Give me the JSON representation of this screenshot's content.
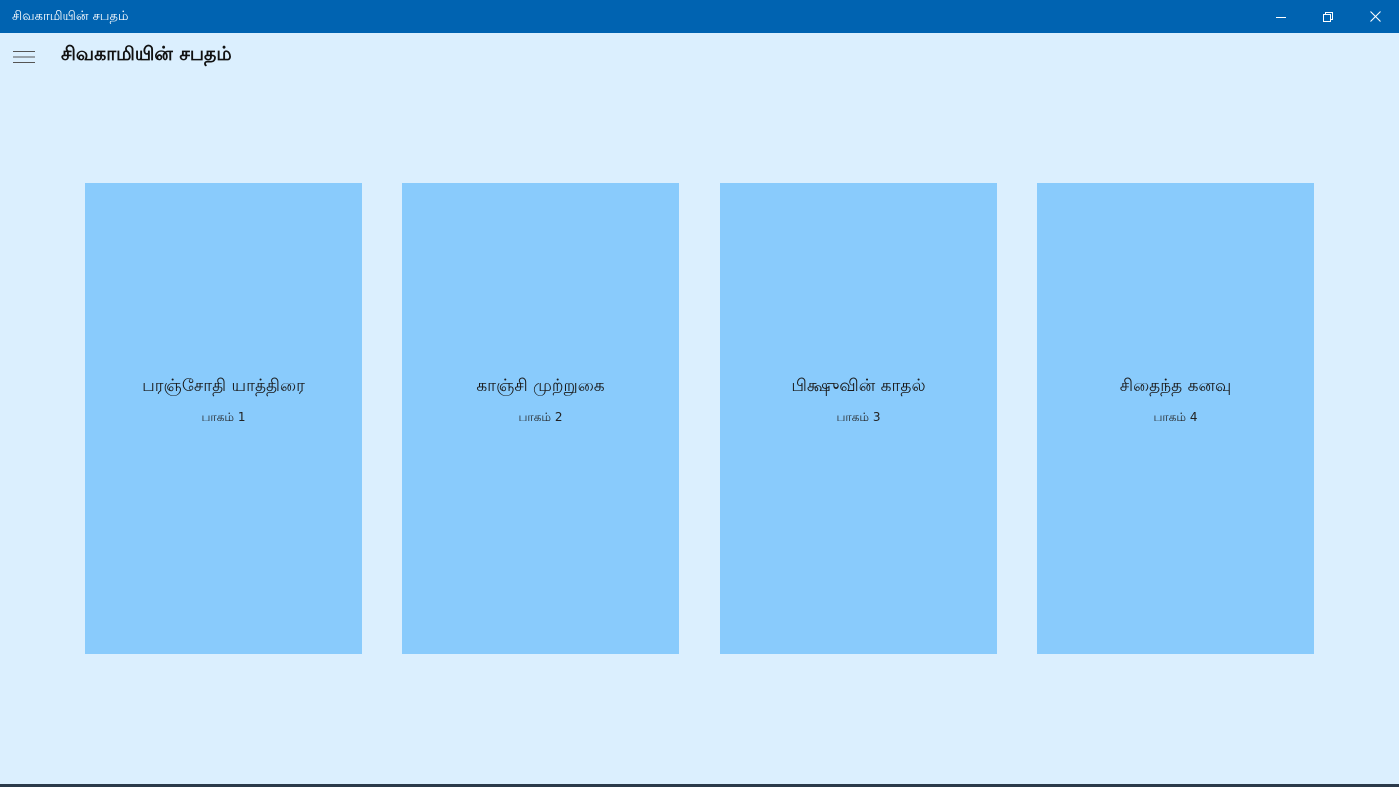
{
  "window": {
    "title": "சிவகாமியின் சபதம்",
    "titlebar_color": "#0063b1",
    "buttons": {
      "minimize": "minimize-icon",
      "restore": "restore-icon",
      "close": "close-icon"
    }
  },
  "appbar": {
    "menu_icon": "hamburger-menu-icon",
    "title": "சிவகாமியின் சபதம்"
  },
  "colors": {
    "background": "#dbeffe",
    "card": "#89cbfc"
  },
  "cards": [
    {
      "title": "பரஞ்சோதி யாத்திரை",
      "subtitle": "பாகம் 1"
    },
    {
      "title": "காஞ்சி முற்றுகை",
      "subtitle": "பாகம் 2"
    },
    {
      "title": "பிக்ஷுவின் காதல்",
      "subtitle": "பாகம் 3"
    },
    {
      "title": "சிதைந்த கனவு",
      "subtitle": "பாகம் 4"
    }
  ]
}
